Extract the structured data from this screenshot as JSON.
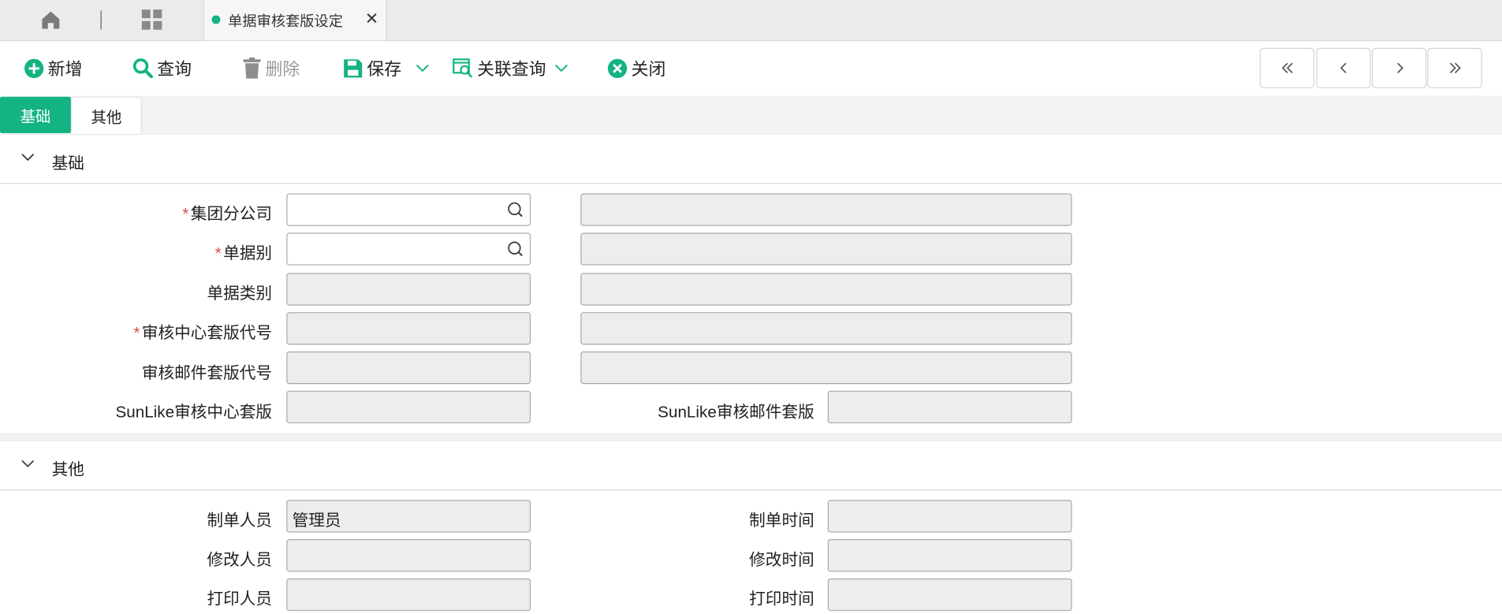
{
  "tabs": {
    "active_title": "单据审核套版设定",
    "close_symbol": "✕"
  },
  "toolbar": {
    "add": "新增",
    "query": "查询",
    "delete": "删除",
    "save": "保存",
    "related_query": "关联查询",
    "close": "关闭",
    "nav": {
      "first": "«",
      "prev": "‹",
      "next": "›",
      "last": "»"
    }
  },
  "subtabs": [
    "基础",
    "其他"
  ],
  "section_basic": {
    "title": "基础",
    "fields": {
      "group_company": {
        "label": "集团分公司",
        "value": "",
        "required": true
      },
      "doc_type": {
        "label": "单据别",
        "value": "",
        "required": true
      },
      "doc_category": {
        "label": "单据类别",
        "value": ""
      },
      "audit_center_template": {
        "label": "审核中心套版代号",
        "value": "",
        "required": true
      },
      "audit_mail_template": {
        "label": "审核邮件套版代号",
        "value": ""
      },
      "sunlike_center": {
        "label": "SunLike审核中心套版",
        "value": ""
      },
      "sunlike_mail": {
        "label": "SunLike审核邮件套版",
        "value": ""
      }
    }
  },
  "section_other": {
    "title": "其他",
    "fields": {
      "creator": {
        "label": "制单人员",
        "value": "管理员"
      },
      "create_time": {
        "label": "制单时间",
        "value": ""
      },
      "modifier": {
        "label": "修改人员",
        "value": ""
      },
      "modify_time": {
        "label": "修改时间",
        "value": ""
      },
      "printer": {
        "label": "打印人员",
        "value": ""
      },
      "print_time": {
        "label": "打印时间",
        "value": ""
      }
    }
  },
  "colors": {
    "accent": "#13b383",
    "required": "#e04848"
  }
}
